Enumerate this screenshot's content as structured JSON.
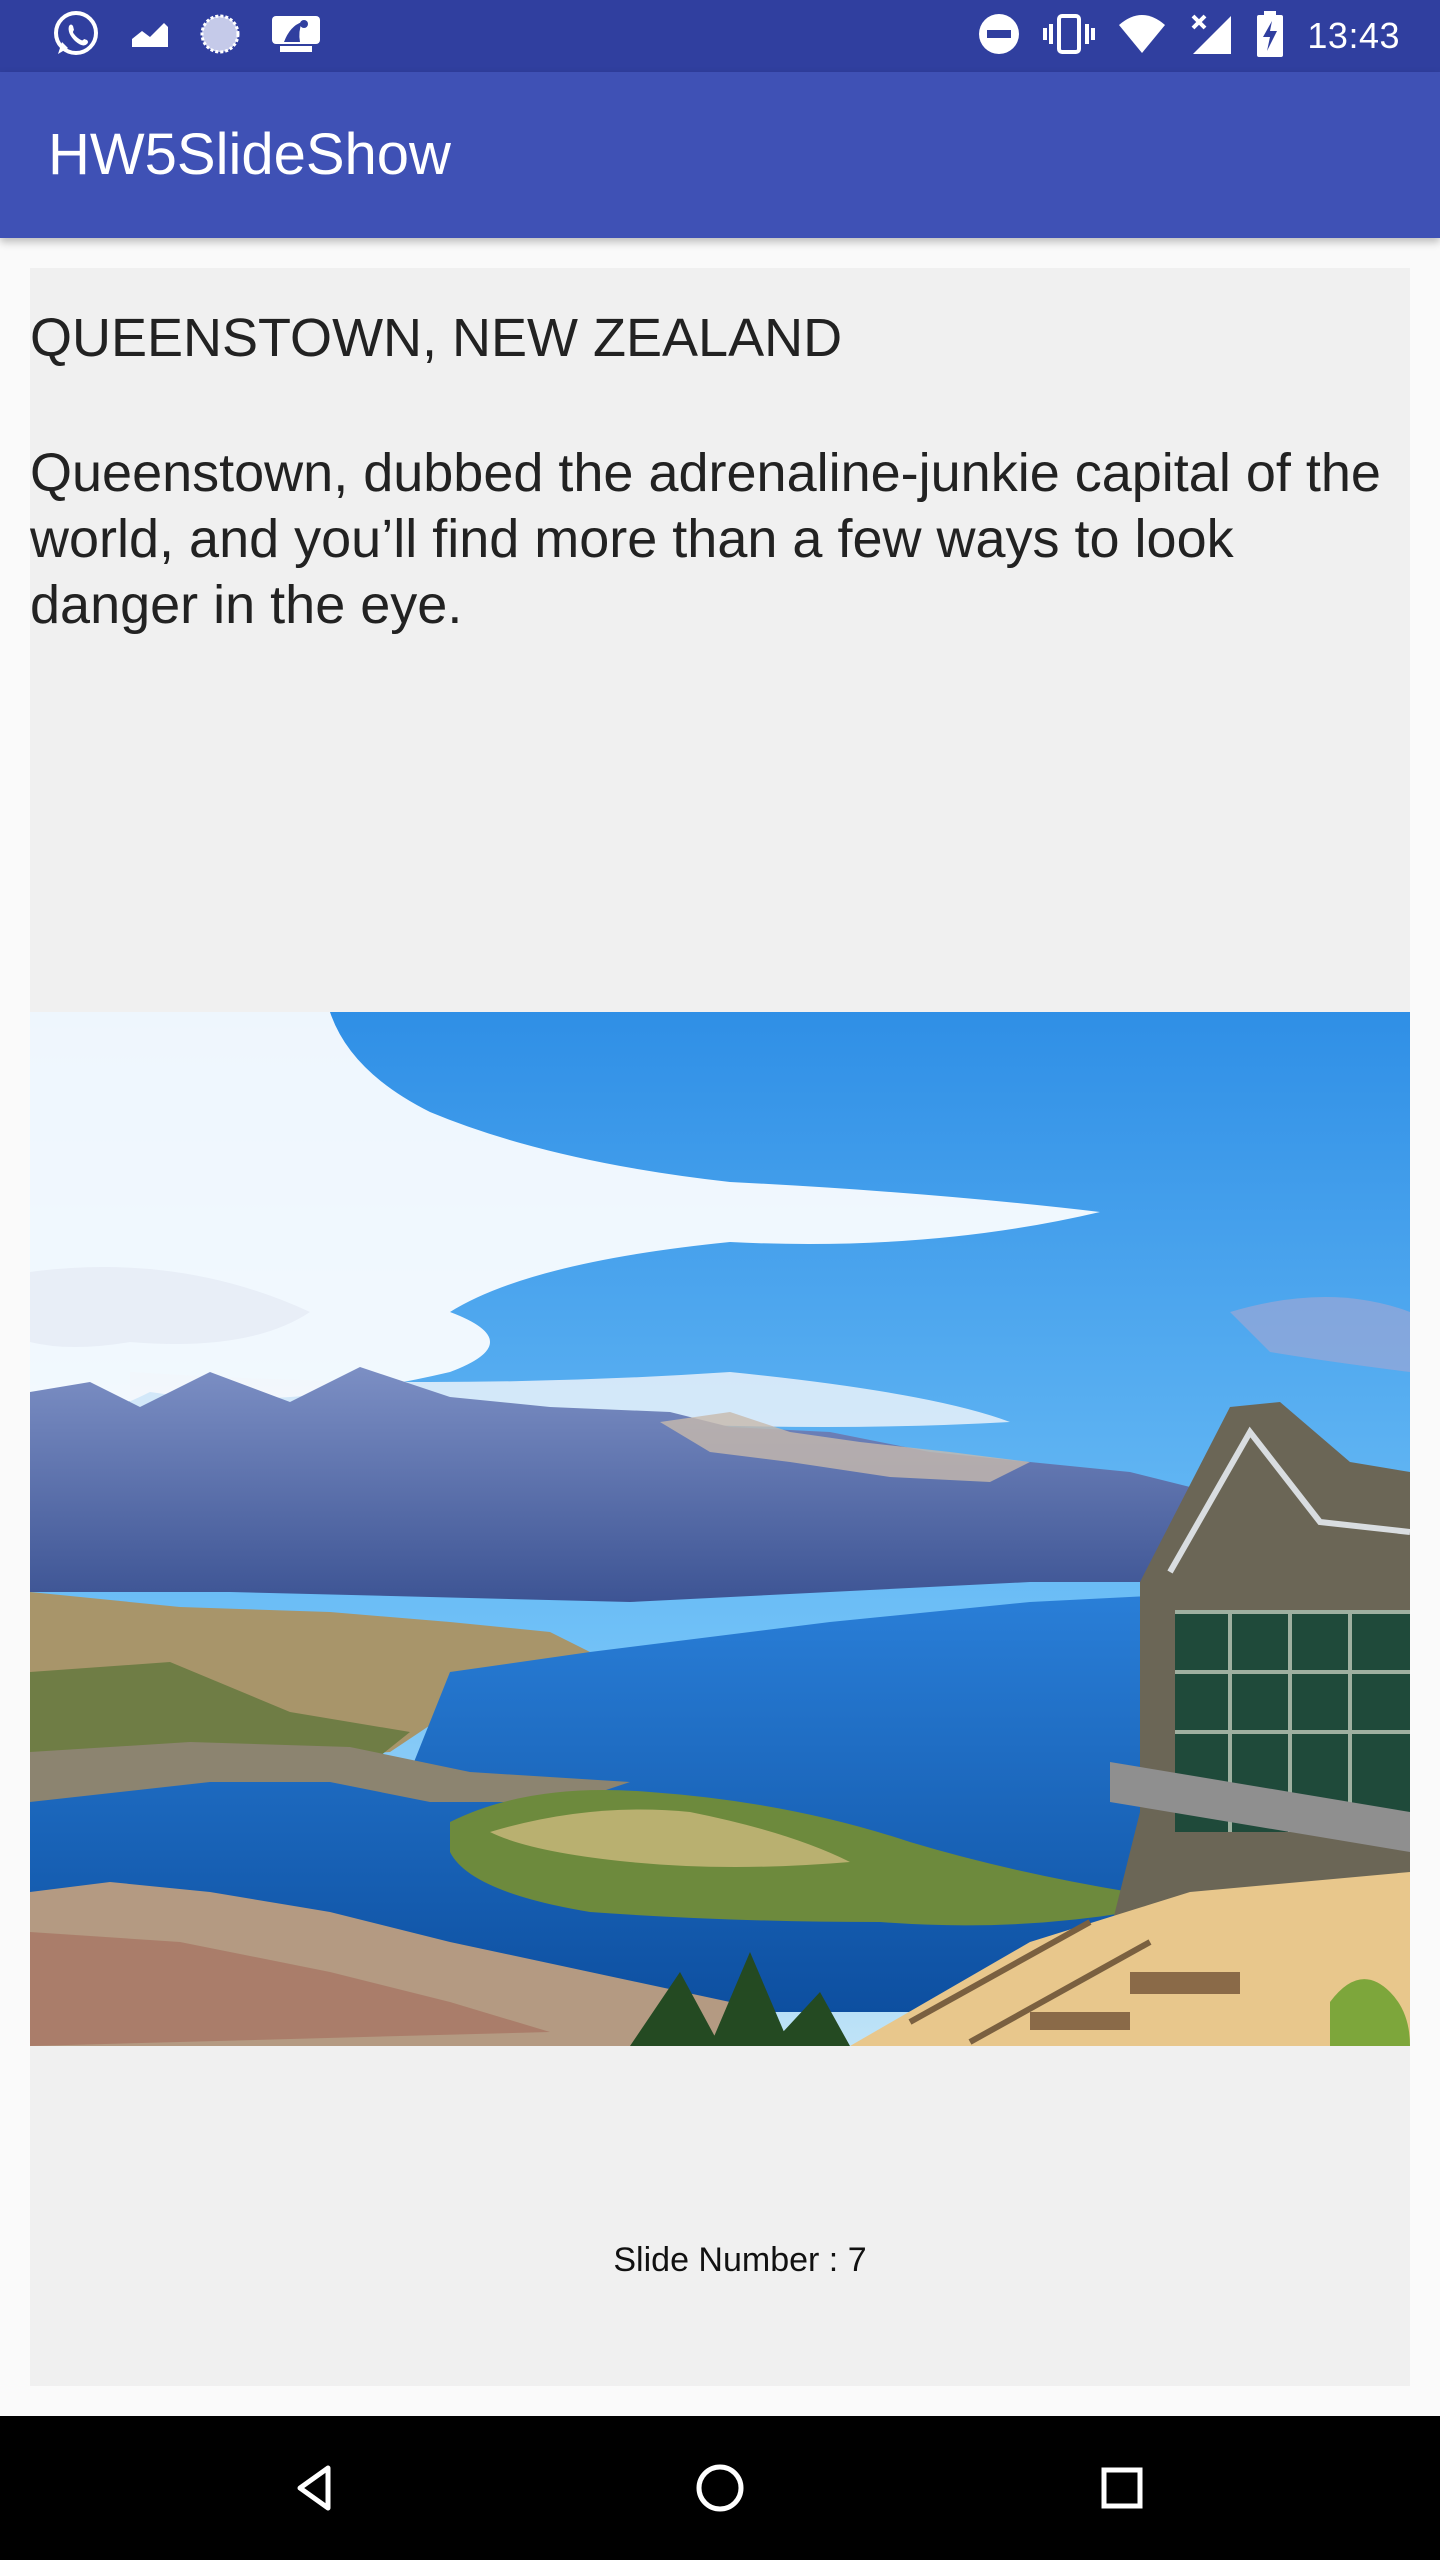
{
  "status_bar": {
    "time": "13:43",
    "left_icons": [
      "whatsapp-icon",
      "chart-icon",
      "loading-icon",
      "mlb-icon"
    ],
    "right_icons": [
      "do-not-disturb-icon",
      "vibrate-icon",
      "wifi-icon",
      "no-signal-icon",
      "battery-charging-icon"
    ]
  },
  "app_bar": {
    "title": "HW5SlideShow"
  },
  "slide": {
    "title": "QUEENSTOWN, NEW ZEALAND",
    "description": "Queenstown, dubbed the adrenaline-junkie capital of the world, and you’ll find more than a few ways to look danger in the eye.",
    "number_label": "Slide Number : 7"
  },
  "nav_bar": {
    "buttons": [
      "back-icon",
      "home-icon",
      "recents-icon"
    ]
  }
}
